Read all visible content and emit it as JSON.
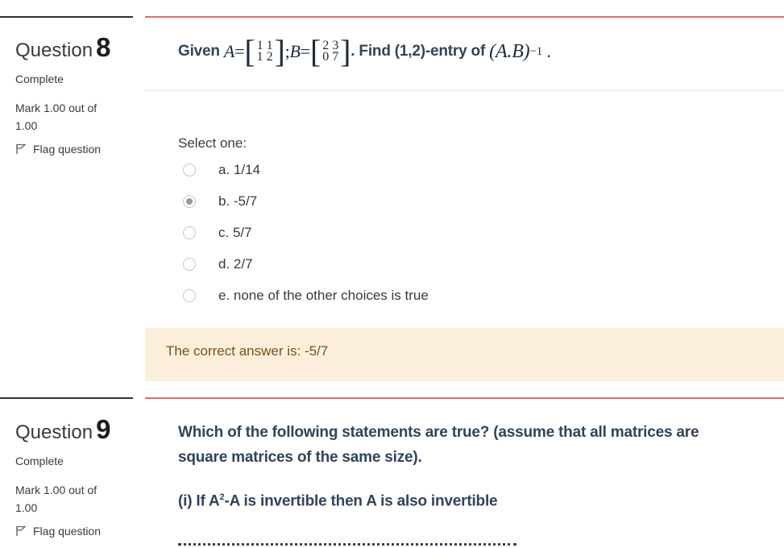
{
  "questions": [
    {
      "label": "Question",
      "number": "8",
      "state": "Complete",
      "mark_line1": "Mark 1.00 out of",
      "mark_line2": "1.00",
      "flag": "Flag question",
      "text_given": "Given",
      "text_find": ". Find (1,2)-entry of",
      "math_a": "A",
      "math_b": "B",
      "math_ab": "(A.B)",
      "math_exp": "−1",
      "matrix_a": [
        "1",
        "1",
        "1",
        "2"
      ],
      "matrix_b": [
        "2",
        "3",
        "0",
        "7"
      ],
      "select_one": "Select one:",
      "options": [
        {
          "label": "a. 1/14",
          "selected": false
        },
        {
          "label": "b. -5/7",
          "selected": true
        },
        {
          "label": "c. 5/7",
          "selected": false
        },
        {
          "label": "d. 2/7",
          "selected": false
        },
        {
          "label": "e. none of the other choices is true",
          "selected": false
        }
      ],
      "feedback": "The correct answer is: -5/7"
    },
    {
      "label": "Question",
      "number": "9",
      "state": "Complete",
      "mark_line1": "Mark 1.00 out of",
      "mark_line2": "1.00",
      "flag": "Flag question",
      "text_line1": "Which of the following statements are true? (assume that all matrices are",
      "text_line2": "square matrices of the same size).",
      "stmt1_a": "(i) If A",
      "stmt1_sup": "2",
      "stmt1_b": "-A is invertible then A is also invertible"
    }
  ],
  "colors": {
    "question_border": "#e36b6b",
    "feedback_bg": "#fcefdc",
    "question_text": "#30445a"
  }
}
